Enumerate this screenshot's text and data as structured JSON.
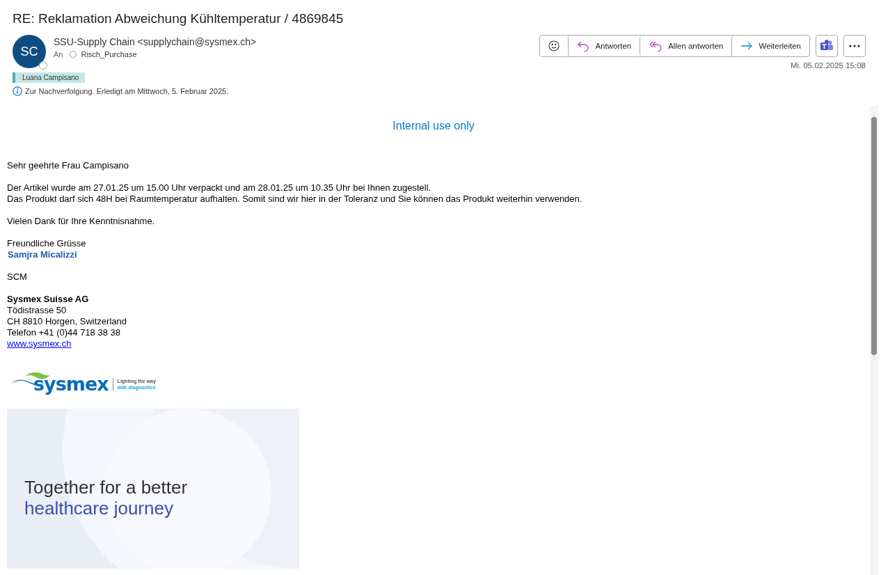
{
  "subject": "RE: Reklamation Abweichung Kühltemperatur / 4869845",
  "sender": {
    "initials": "SC",
    "name": "SSU-Supply Chain <supplychain@sysmex.ch>",
    "to_label": "An",
    "recipient": "Risch_Purchase"
  },
  "category": {
    "label": "Luana Campisano",
    "color": "#4fb3b3"
  },
  "followup": "Zur Nachverfolgung.  Erledigt am Mittwoch, 5. Februar 2025.",
  "actions": [
    {
      "kind": "emoji"
    },
    {
      "kind": "reply",
      "label": "Antworten"
    },
    {
      "kind": "reply_all",
      "label": "Allen antworten"
    },
    {
      "kind": "forward",
      "label": "Weiterleiten"
    }
  ],
  "extra_buttons": [
    {
      "kind": "teams"
    },
    {
      "kind": "more"
    }
  ],
  "date": "Mi. 05.02.2025 15:08",
  "body": {
    "classification": "Internal use only",
    "paragraphs": [
      [
        "Sehr geehrte Frau Campisano"
      ],
      [
        "Der Artikel wurde am 27.01.25 um 15.00 Uhr verpackt und am 28.01.25 um 10.35 Uhr bei Ihnen zugestell.",
        "Das Produkt darf sich 48H bei Raumtemperatur aufhalten. Somit sind wir hier in der Toleranz und Sie können das Produkt weiterhin verwenden."
      ],
      [
        "Vielen Dank für Ihre Kenntnisnahme."
      ],
      [
        "Freundliche Grüsse"
      ]
    ],
    "signature_name": "Samjra Micalizzi",
    "department": "SCM",
    "company": "Sysmex Suisse AG",
    "address": [
      "Tödistrasse 50",
      "CH 8810 Horgen, Switzerland",
      "Telefon +41 (0)44 718 38 38"
    ],
    "website": "www.sysmex.ch",
    "logo": {
      "wordmark": "sysmex",
      "tagline": [
        "Lighting the way",
        "with diagnostics"
      ]
    },
    "banner": [
      "Together for a better",
      "healthcare journey"
    ]
  }
}
